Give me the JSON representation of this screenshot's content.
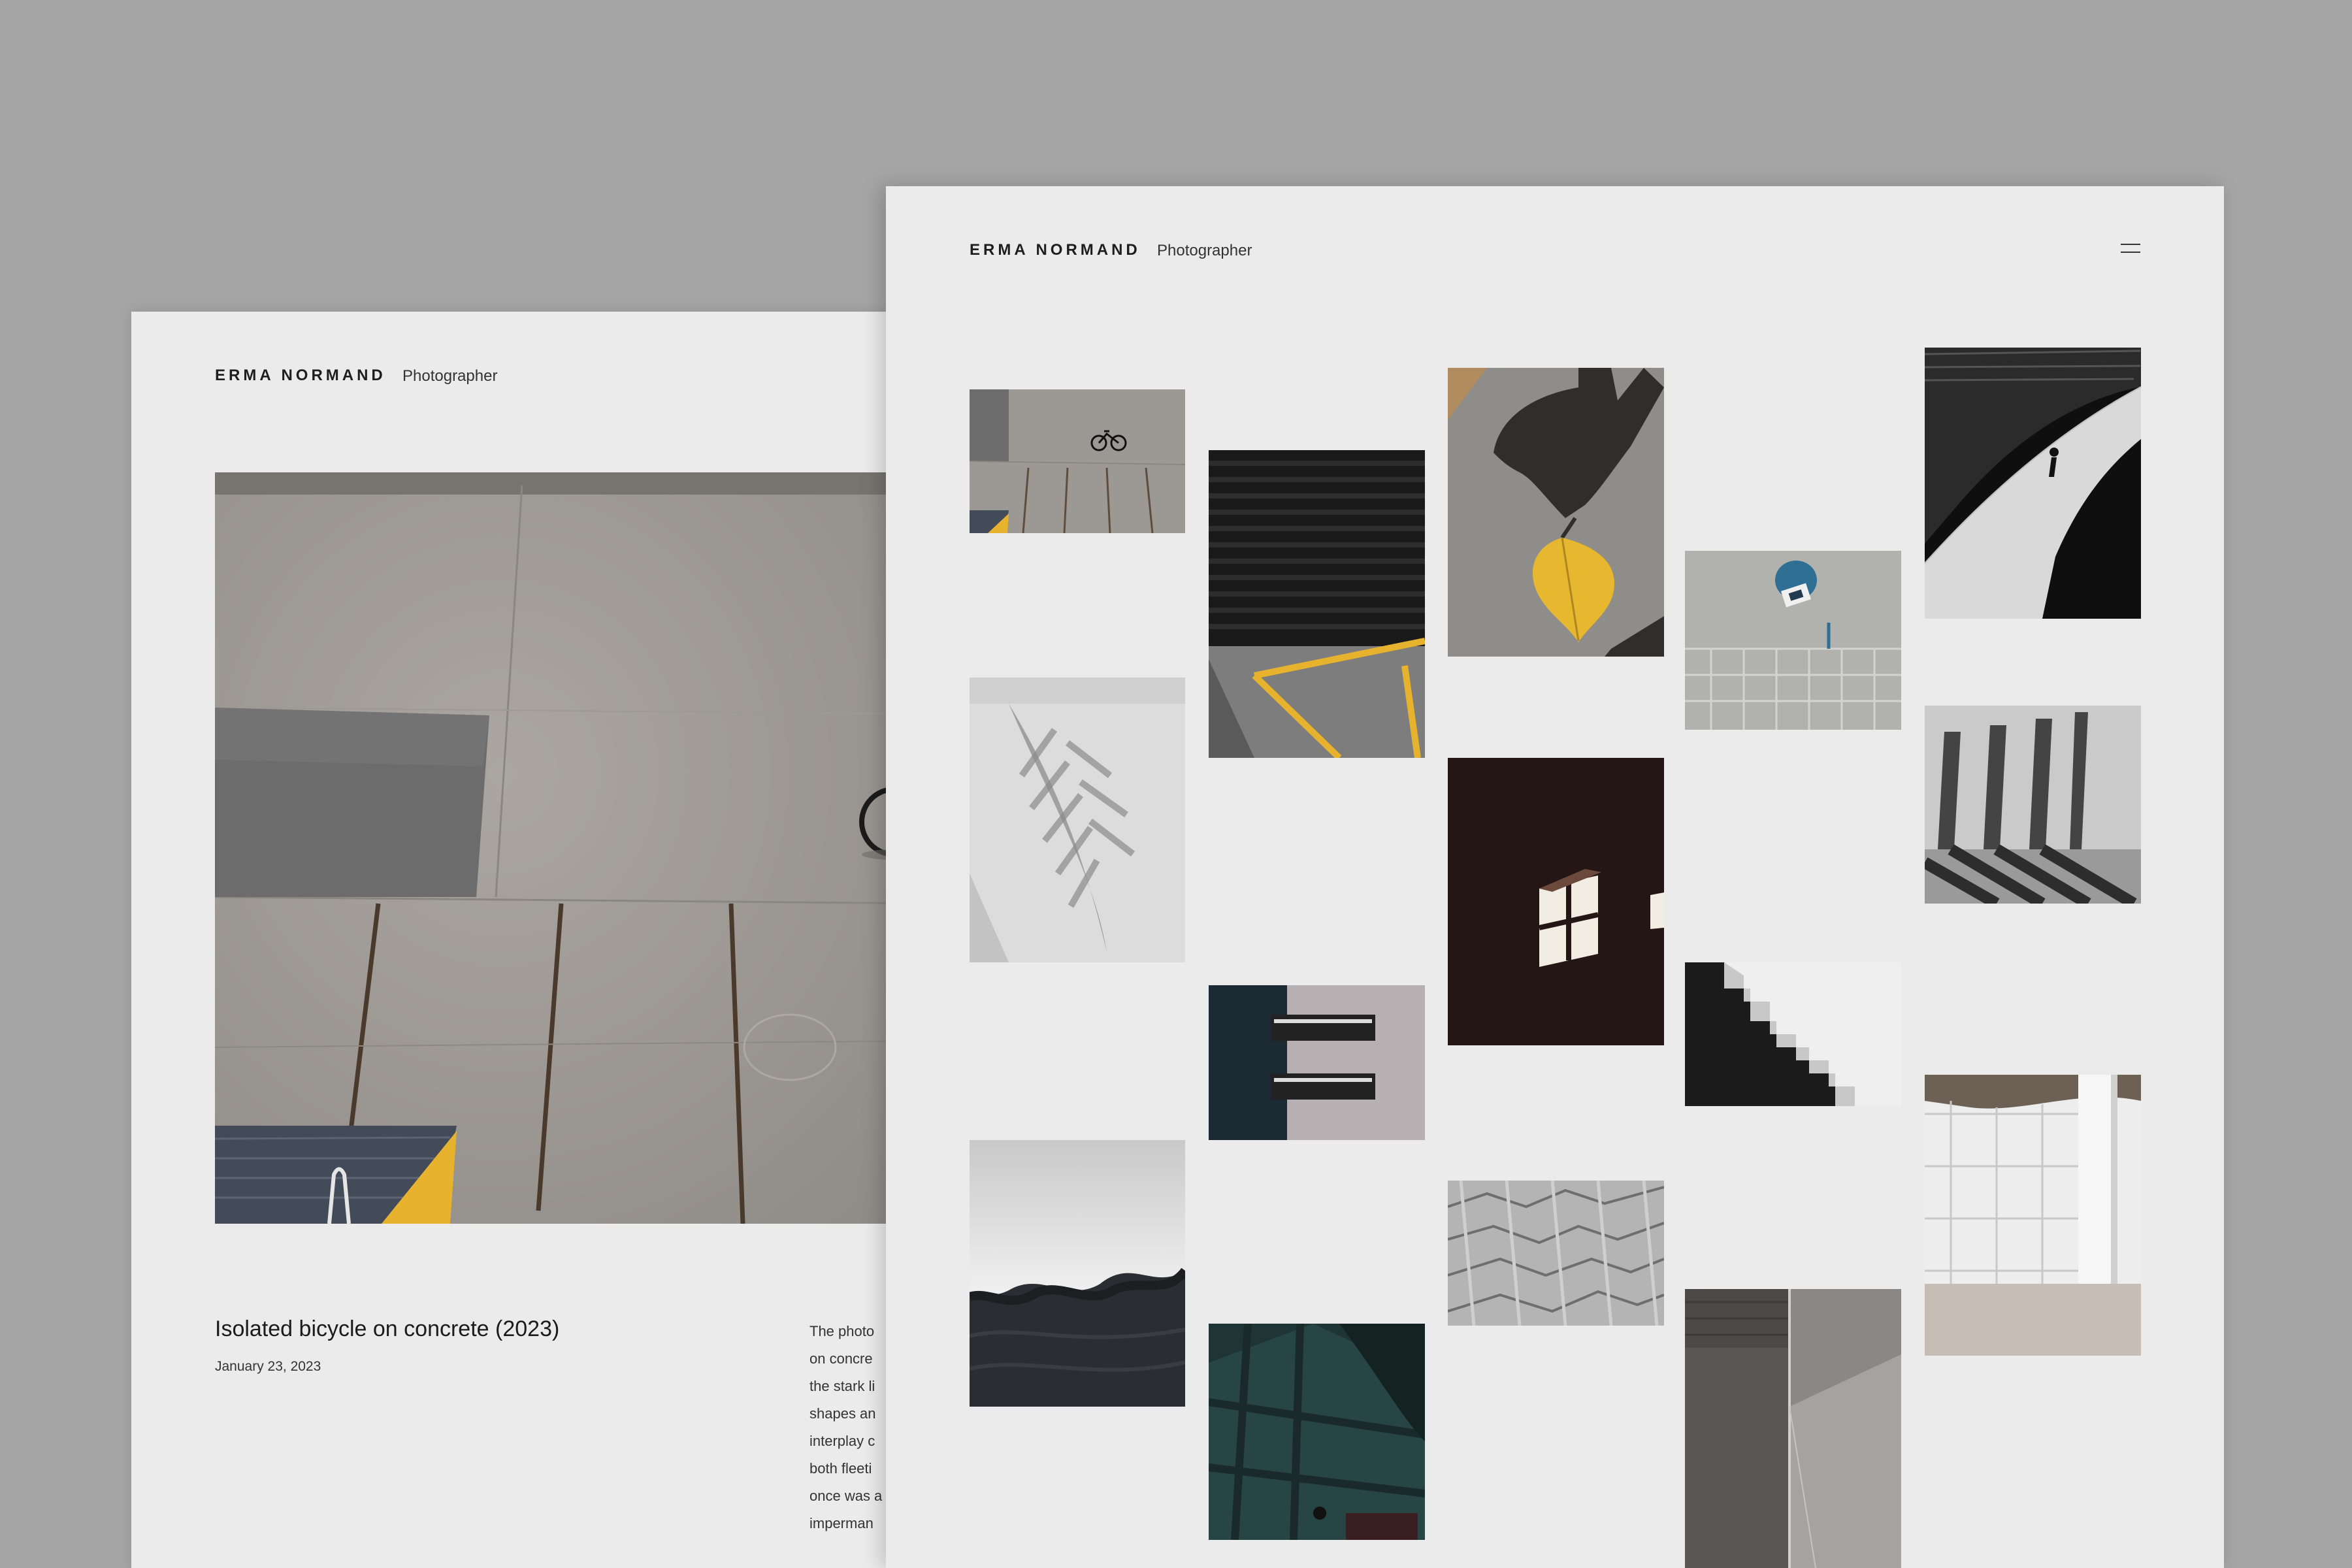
{
  "site": {
    "brand": "ERMA NORMAND",
    "role": "Photographer"
  },
  "post": {
    "title": "Isolated bicycle on concrete (2023)",
    "date": "January 23, 2023",
    "body_lines": [
      "The photo",
      "on concre",
      "the stark li",
      "shapes an",
      "interplay c",
      "both fleeti",
      "once was a",
      "imperman"
    ]
  },
  "icons": {
    "menu": "hamburger-menu-icon"
  },
  "colors": {
    "backdrop": "#a5a5a5",
    "page": "#ebebeb",
    "accent_yellow": "#e7b22d"
  },
  "gallery": {
    "thumbnails": [
      {
        "id": "bicycle-aerial"
      },
      {
        "id": "palm-shadow"
      },
      {
        "id": "frozen-wave"
      },
      {
        "id": "garage-yellow-line"
      },
      {
        "id": "window-building"
      },
      {
        "id": "teal-shadow"
      },
      {
        "id": "hand-shadow-leaf"
      },
      {
        "id": "window-light-dark"
      },
      {
        "id": "zigzag-pavement"
      },
      {
        "id": "umbrella-aerial"
      },
      {
        "id": "white-staircase"
      },
      {
        "id": "concrete-corner"
      },
      {
        "id": "curve-walker"
      },
      {
        "id": "column-shadows"
      },
      {
        "id": "white-columns"
      }
    ]
  }
}
